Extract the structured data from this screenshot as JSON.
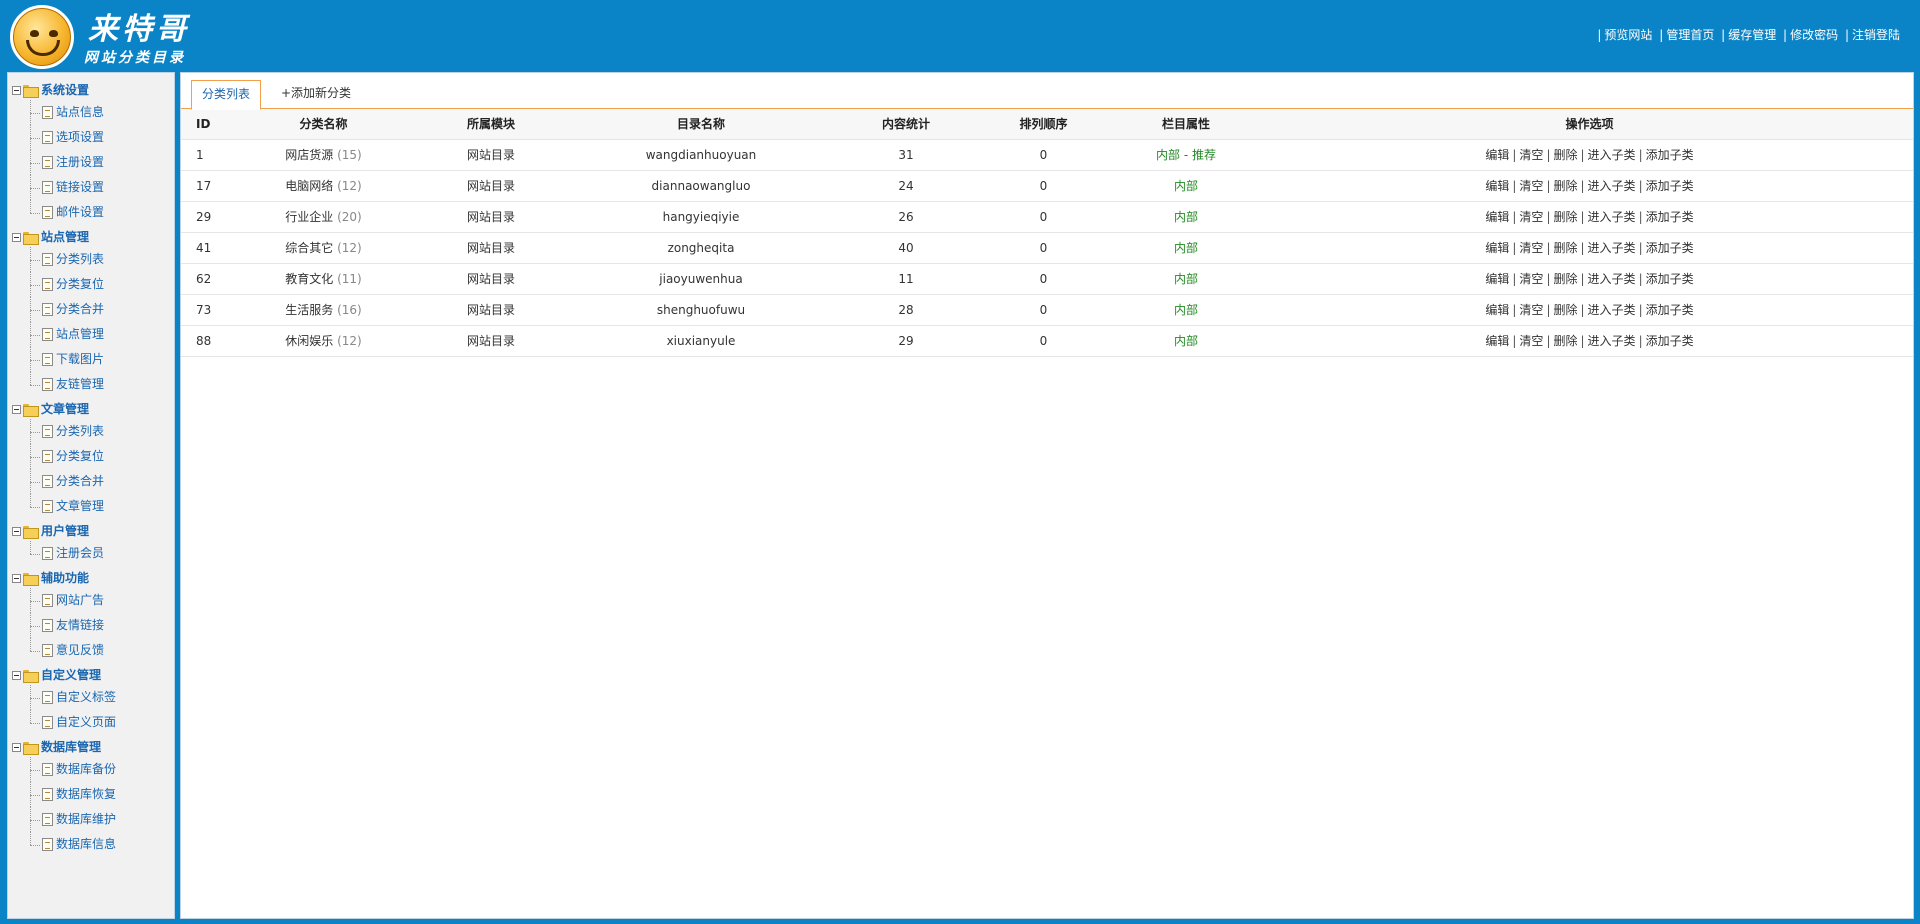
{
  "header": {
    "title": "来特哥",
    "subtitle": "网站分类目录",
    "links": [
      "预览网站",
      "管理首页",
      "缓存管理",
      "修改密码",
      "注销登陆"
    ],
    "bg_color": "#0a84c6"
  },
  "sidebar": {
    "groups": [
      {
        "title": "系统设置",
        "items": [
          "站点信息",
          "选项设置",
          "注册设置",
          "链接设置",
          "邮件设置"
        ]
      },
      {
        "title": "站点管理",
        "items": [
          "分类列表",
          "分类复位",
          "分类合并",
          "站点管理",
          "下载图片",
          "友链管理"
        ]
      },
      {
        "title": "文章管理",
        "items": [
          "分类列表",
          "分类复位",
          "分类合并",
          "文章管理"
        ]
      },
      {
        "title": "用户管理",
        "items": [
          "注册会员"
        ]
      },
      {
        "title": "辅助功能",
        "items": [
          "网站广告",
          "友情链接",
          "意见反馈"
        ]
      },
      {
        "title": "自定义管理",
        "items": [
          "自定义标签",
          "自定义页面"
        ]
      },
      {
        "title": "数据库管理",
        "items": [
          "数据库备份",
          "数据库恢复",
          "数据库维护",
          "数据库信息"
        ]
      }
    ]
  },
  "main": {
    "tabs": {
      "active": "分类列表",
      "add": "+添加新分类"
    },
    "columns": [
      "ID",
      "分类名称",
      "所属模块",
      "目录名称",
      "内容统计",
      "排列顺序",
      "栏目属性",
      "操作选项"
    ],
    "rows": [
      {
        "id": "1",
        "name": "网店货源",
        "count": "(15)",
        "module": "网站目录",
        "dir": "wangdianhuoyuan",
        "stat": "31",
        "order": "0",
        "attr": "内部 - 推荐"
      },
      {
        "id": "17",
        "name": "电脑网络",
        "count": "(12)",
        "module": "网站目录",
        "dir": "diannaowangluo",
        "stat": "24",
        "order": "0",
        "attr": "内部"
      },
      {
        "id": "29",
        "name": "行业企业",
        "count": "(20)",
        "module": "网站目录",
        "dir": "hangyieqiyie",
        "stat": "26",
        "order": "0",
        "attr": "内部"
      },
      {
        "id": "41",
        "name": "综合其它",
        "count": "(12)",
        "module": "网站目录",
        "dir": "zongheqita",
        "stat": "40",
        "order": "0",
        "attr": "内部"
      },
      {
        "id": "62",
        "name": "教育文化",
        "count": "(11)",
        "module": "网站目录",
        "dir": "jiaoyuwenhua",
        "stat": "11",
        "order": "0",
        "attr": "内部"
      },
      {
        "id": "73",
        "name": "生活服务",
        "count": "(16)",
        "module": "网站目录",
        "dir": "shenghuofuwu",
        "stat": "28",
        "order": "0",
        "attr": "内部"
      },
      {
        "id": "88",
        "name": "休闲娱乐",
        "count": "(12)",
        "module": "网站目录",
        "dir": "xiuxianyule",
        "stat": "29",
        "order": "0",
        "attr": "内部"
      }
    ],
    "ops": [
      "编辑",
      "清空",
      "删除",
      "进入子类",
      "添加子类"
    ]
  }
}
